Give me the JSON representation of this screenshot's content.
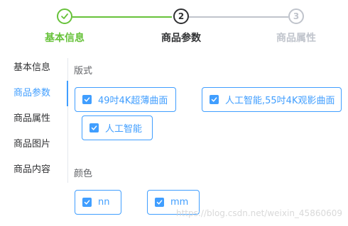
{
  "steps": [
    {
      "title": "基本信息",
      "number": "",
      "status": "success"
    },
    {
      "title": "商品参数",
      "number": "2",
      "status": "process"
    },
    {
      "title": "商品属性",
      "number": "3",
      "status": "wait"
    }
  ],
  "tabs": [
    "基本信息",
    "商品参数",
    "商品属性",
    "商品图片",
    "商品内容"
  ],
  "active_tab": "商品参数",
  "params": [
    {
      "label": "版式",
      "options": [
        "49吋4K超薄曲面",
        "人工智能,55吋4K观影曲面",
        "人工智能"
      ],
      "checked": [
        true,
        true,
        true
      ]
    },
    {
      "label": "颜色",
      "options": [
        "nn",
        "mm"
      ],
      "checked": [
        true,
        true
      ]
    }
  ],
  "watermark": "https://blog.csdn.net/weixin_45860609",
  "colors": {
    "primary": "#409eff",
    "success": "#67c23a",
    "wait": "#c0c4cc",
    "text": "#303133"
  }
}
